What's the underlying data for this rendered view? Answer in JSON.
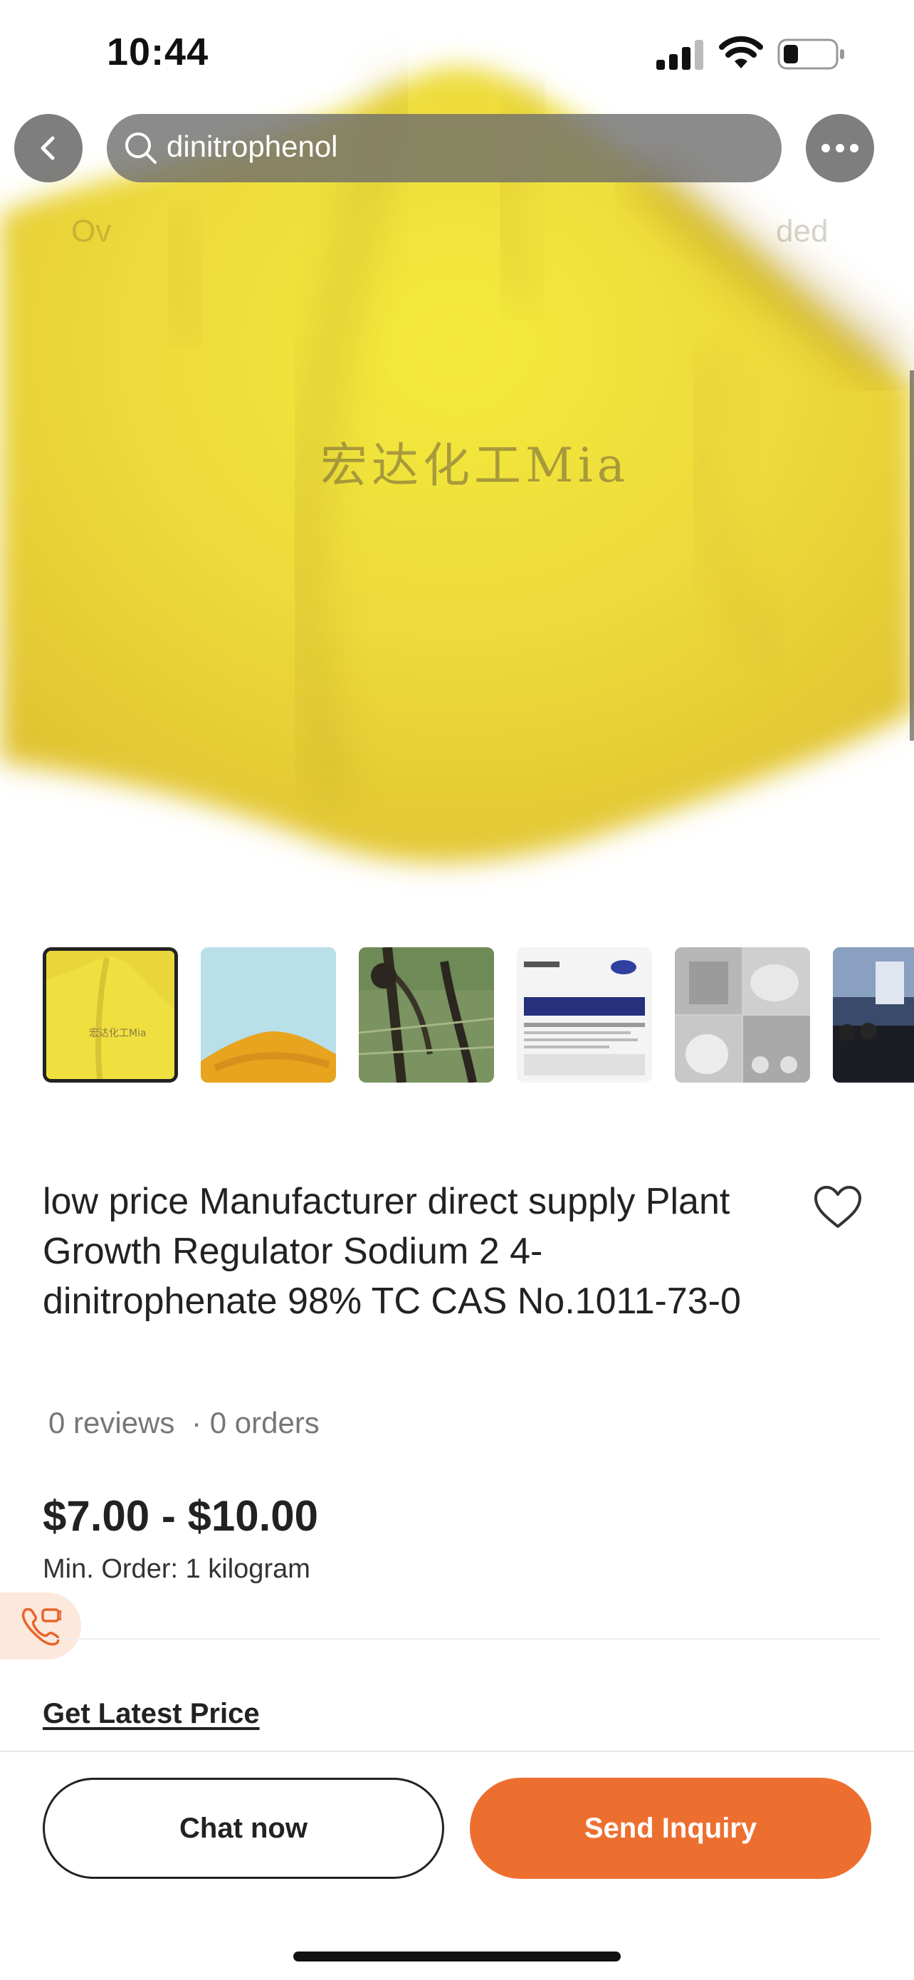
{
  "status_bar": {
    "time": "10:44"
  },
  "search": {
    "query": "dinitrophenol"
  },
  "hero": {
    "watermark": "宏达化工Mia",
    "ghost_tabs": [
      "Ov",
      "ded"
    ]
  },
  "thumbnails": [
    {
      "name": "yellow-powder-thumb",
      "active": true,
      "watermark": "宏达化工Mia"
    },
    {
      "name": "orange-powder-thumb",
      "active": false
    },
    {
      "name": "plant-roots-thumb",
      "active": false
    },
    {
      "name": "label-document-thumb",
      "active": false
    },
    {
      "name": "packaging-collage-thumb",
      "active": false
    },
    {
      "name": "exhibition-thumb",
      "active": false
    }
  ],
  "product": {
    "title": "low price Manufacturer direct supply Plant Growth Regulator Sodium 2 4-dinitrophenate 98% TC CAS No.1011-73-0",
    "reviews": "0 reviews",
    "orders": "· 0 orders",
    "price": "$7.00 - $10.00",
    "min_order": "Min. Order: 1 kilogram",
    "latest_price_link": "Get Latest Price"
  },
  "actions": {
    "chat": "Chat now",
    "inquiry": "Send Inquiry"
  },
  "colors": {
    "accent": "#ed6f30",
    "call_badge_bg": "#fde8dc"
  }
}
